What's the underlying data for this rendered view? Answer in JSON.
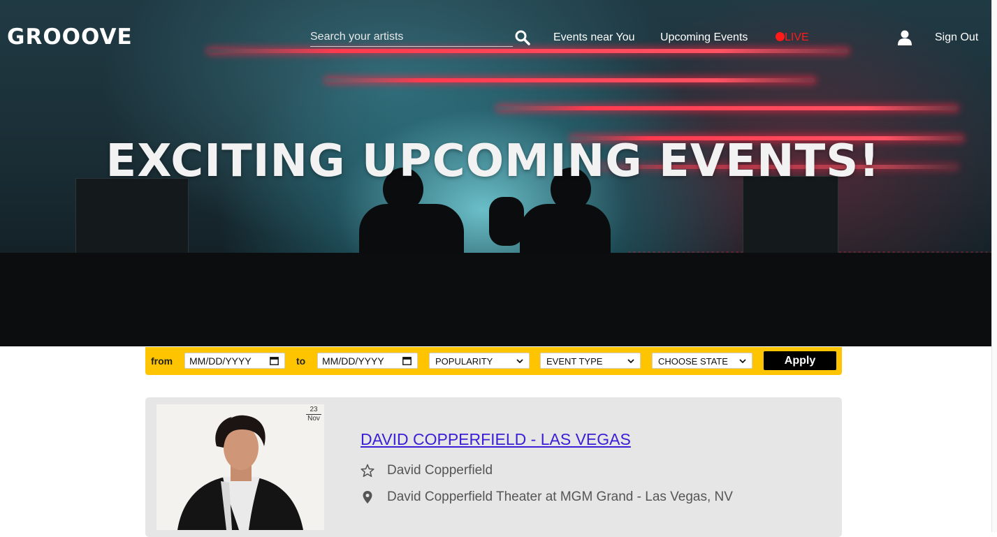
{
  "brand": {
    "logo_text": "GROOOVE"
  },
  "nav": {
    "search_placeholder": "Search your artists",
    "events_near_you": "Events near You",
    "upcoming_events": "Upcoming Events",
    "live": "LIVE",
    "sign_out": "Sign Out",
    "live_color": "#ff1a1a"
  },
  "hero": {
    "headline": "EXCITING UPCOMING EVENTS!"
  },
  "filters": {
    "from_label": "from",
    "to_label": "to",
    "from_date_placeholder": "MM/DD/YYYY",
    "to_date_placeholder": "MM/DD/YYYY",
    "popularity": "POPULARITY",
    "event_type": "EVENT TYPE",
    "state": "CHOOSE STATE",
    "apply": "Apply",
    "bar_color": "#ffc400"
  },
  "events": [
    {
      "day": "23",
      "month": "Nov",
      "title": "DAVID COPPERFIELD - LAS VEGAS",
      "artist": "David Copperfield",
      "venue": "David Copperfield Theater at MGM Grand - Las Vegas, NV",
      "title_color": "#3a1fd6"
    }
  ]
}
